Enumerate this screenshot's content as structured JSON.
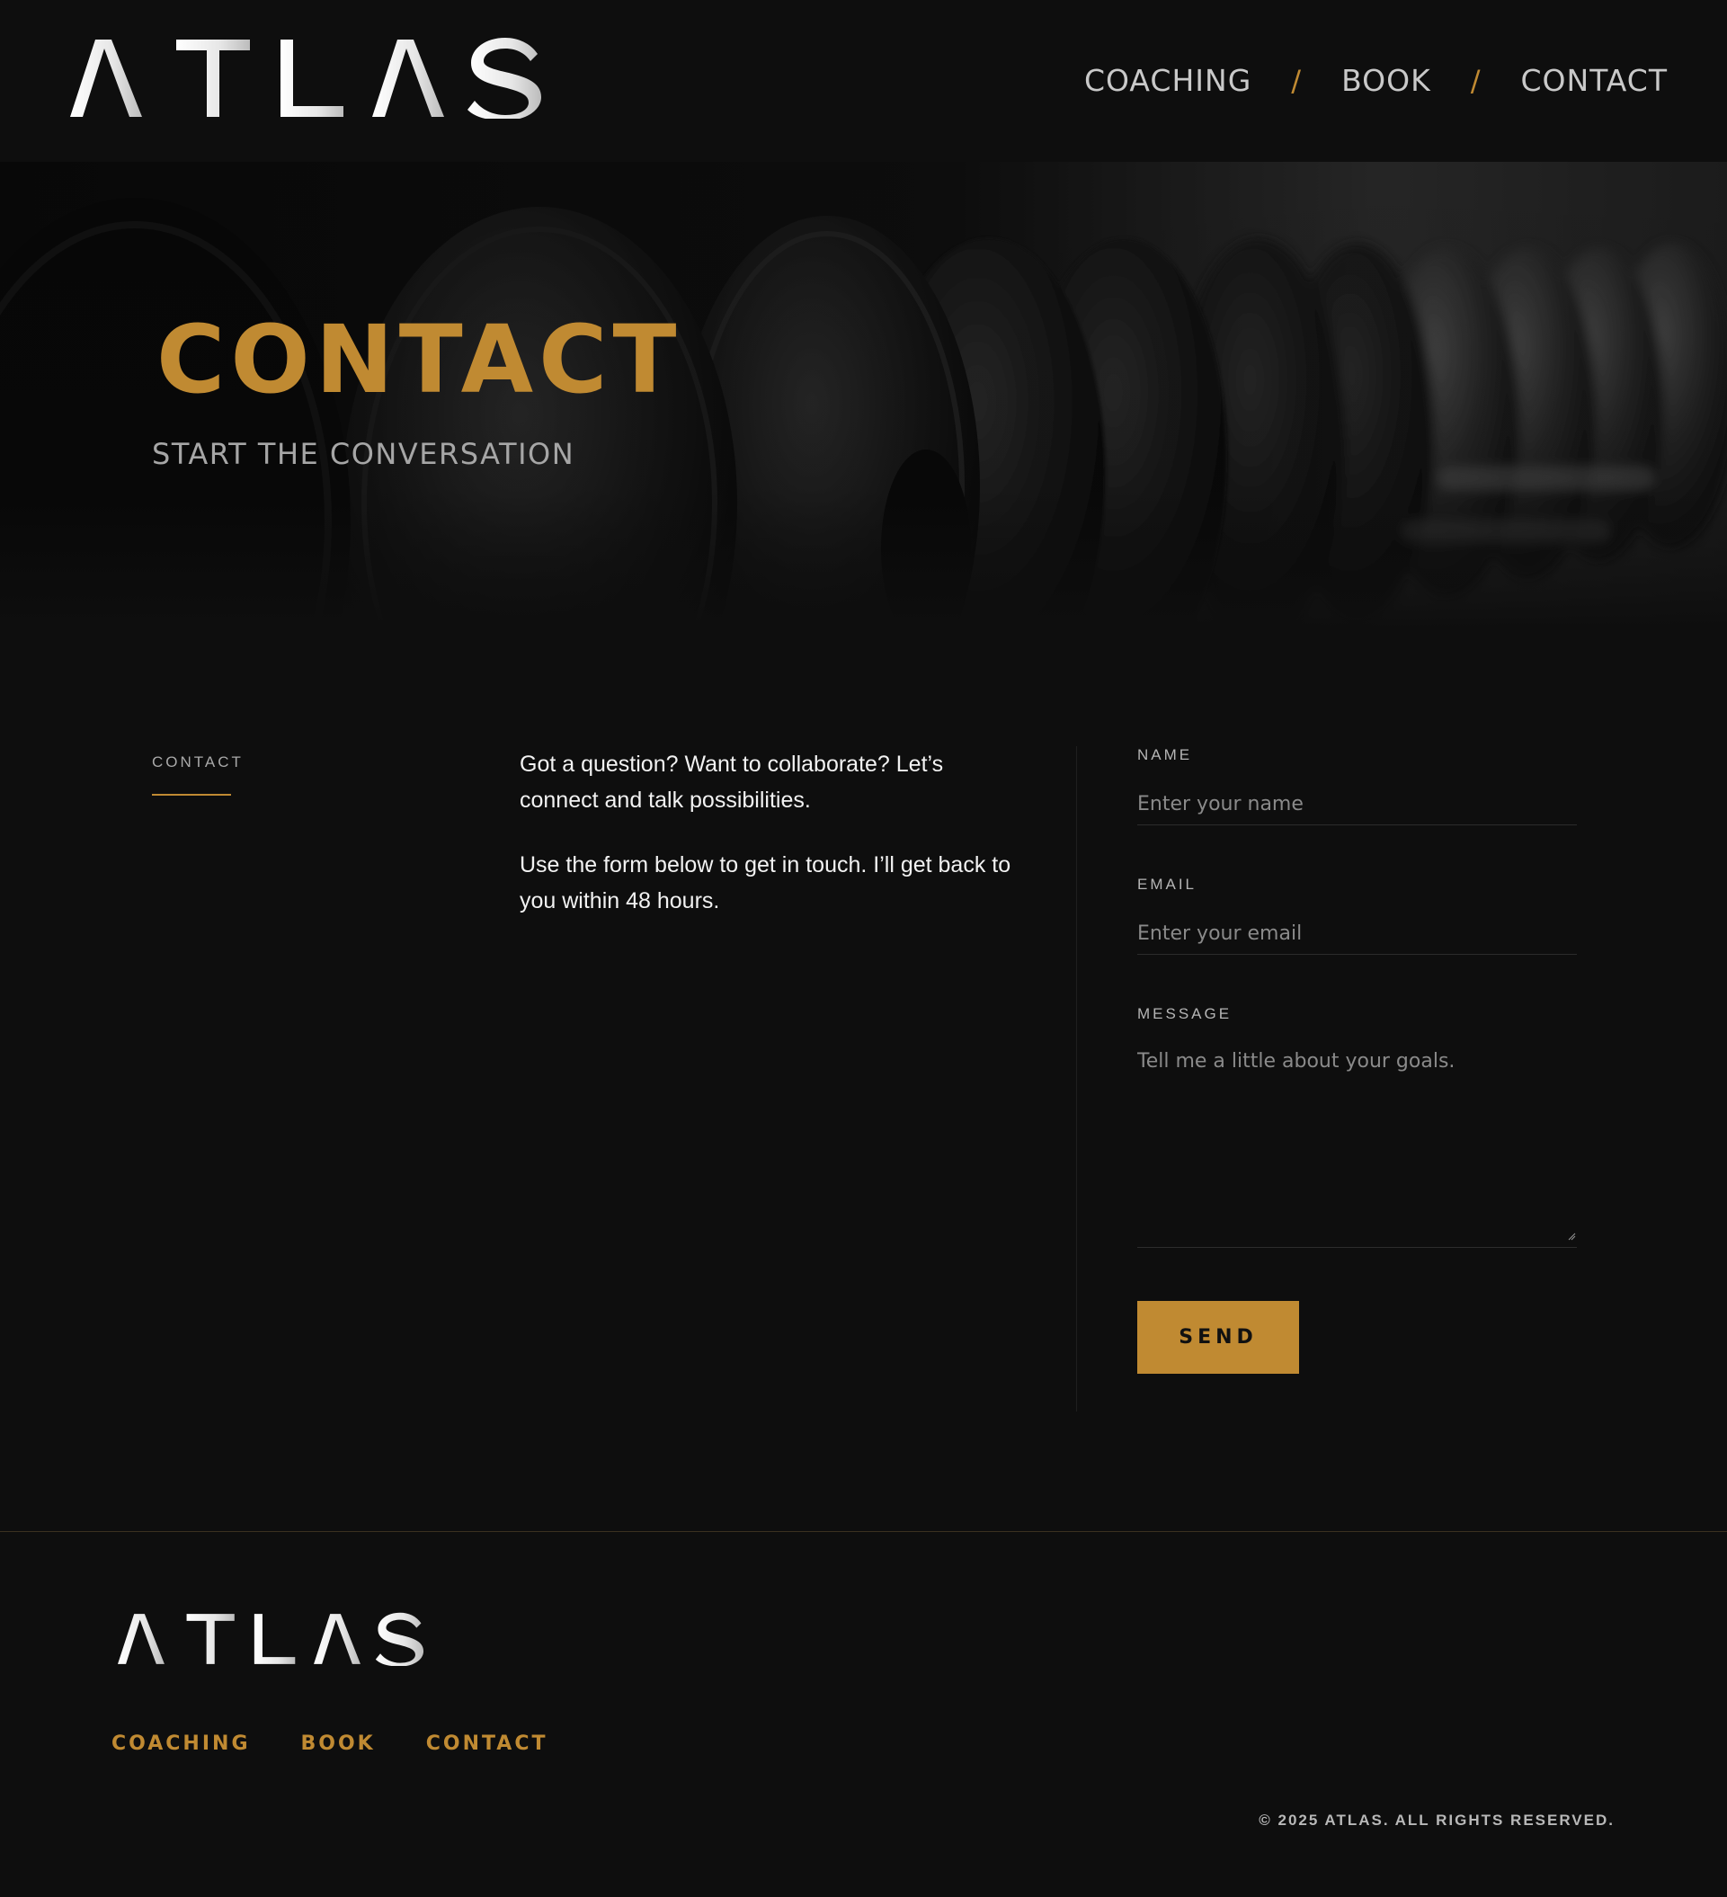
{
  "brand": {
    "logo_text": "ATLAS"
  },
  "nav": {
    "items": [
      {
        "label": "COACHING"
      },
      {
        "label": "BOOK"
      },
      {
        "label": "CONTACT"
      }
    ],
    "separator": "/"
  },
  "hero": {
    "title": "CONTACT",
    "subtitle": "START THE CONVERSATION"
  },
  "section": {
    "label": "CONTACT"
  },
  "intro": {
    "paragraph_1": "Got a question? Want to collaborate? Let’s connect and talk possibilities.",
    "paragraph_2": "Use the form below to get in touch. I’ll get back to you within 48 hours."
  },
  "form": {
    "name": {
      "label": "NAME",
      "placeholder": "Enter your name",
      "value": ""
    },
    "email": {
      "label": "EMAIL",
      "placeholder": "Enter your email",
      "value": ""
    },
    "message": {
      "label": "MESSAGE",
      "placeholder": "Tell me a little about your goals.",
      "value": ""
    },
    "submit_label": "SEND"
  },
  "footer": {
    "logo_text": "ATLAS",
    "links": [
      {
        "label": "COACHING"
      },
      {
        "label": "BOOK"
      },
      {
        "label": "CONTACT"
      }
    ],
    "copyright": "© 2025 ATLAS. ALL RIGHTS RESERVED."
  },
  "colors": {
    "background": "#0e0e0e",
    "accent": "#c08a32",
    "text": "#f2f2f2",
    "muted": "#a6a6a6"
  },
  "icons": {
    "resize_grip": "resize-grip-icon"
  }
}
